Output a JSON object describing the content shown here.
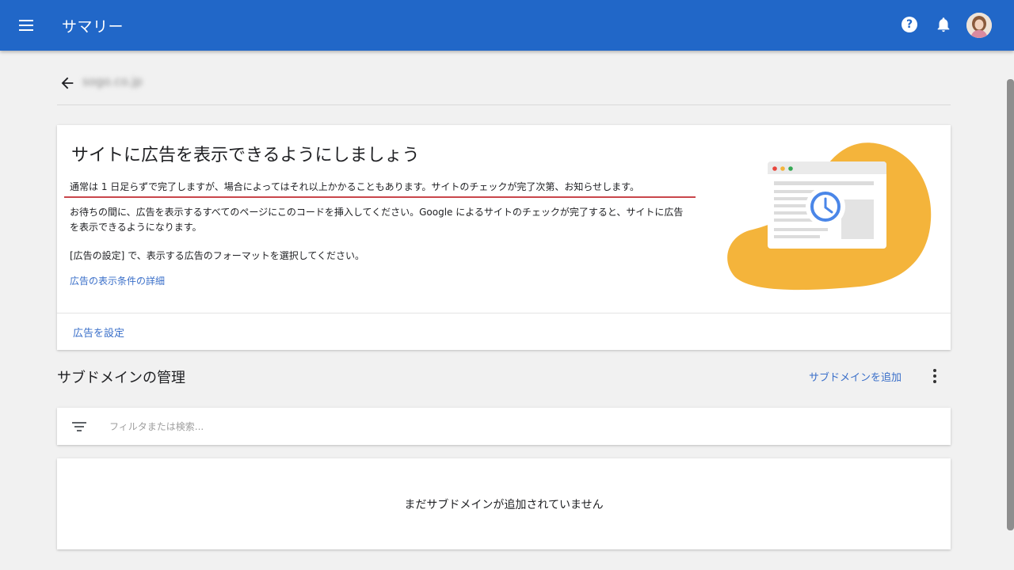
{
  "appbar": {
    "title": "サマリー",
    "menu_icon": "hamburger-menu-icon",
    "help_icon": "help-circle-icon",
    "help_glyph": "?",
    "notifications_icon": "bell-icon",
    "avatar_icon": "user-avatar"
  },
  "site": {
    "name": "sogo.co.jp"
  },
  "setup_card": {
    "title": "サイトに広告を表示できるようにしましょう",
    "p1": "通常は 1 日足らずで完了しますが、場合によってはそれ以上かかることもあります。サイトのチェックが完了次第、お知らせします。",
    "p2": "お待ちの間に、広告を表示するすべてのページにこのコードを挿入してください。Google によるサイトのチェックが完了すると、サイトに広告を表示できるようになります。",
    "p3": "[広告の設定] で、表示する広告のフォーマットを選択してください。",
    "details_link": "広告の表示条件の詳細",
    "setup_link": "広告を設定"
  },
  "subdomains": {
    "title": "サブドメインの管理",
    "add_link": "サブドメインを追加",
    "filter_placeholder": "フィルタまたは検索...",
    "empty_message": "まだサブドメインが追加されていません"
  },
  "colors": {
    "appbar": "#2167c8",
    "link": "#3a6fc9",
    "illustration_blob": "#f4b43b",
    "clock": "#4a86e8",
    "underline": "#c9464b"
  }
}
